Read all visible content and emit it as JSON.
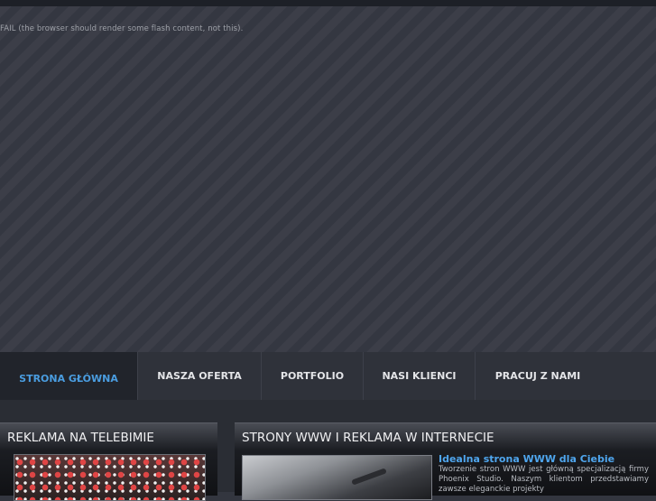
{
  "flash": {
    "fail_text": "FAIL (the browser should render some flash content, not this)."
  },
  "nav": {
    "items": [
      {
        "label": "STRONA GŁÓWNA",
        "active": true
      },
      {
        "label": "NASZA OFERTA",
        "active": false
      },
      {
        "label": "PORTFOLIO",
        "active": false
      },
      {
        "label": "NASI KLIENCI",
        "active": false
      },
      {
        "label": "PRACUJ Z NAMI",
        "active": false
      }
    ]
  },
  "panels": {
    "left": {
      "title": "REKLAMA NA TELEBIMIE"
    },
    "right": {
      "title": "STRONY WWW I REKLAMA W INTERNECIE",
      "article_title": "Idealna strona WWW dla Ciebie",
      "article_text": "Tworzenie stron WWW jest główną specjalizacją firmy Phoenix Studio. Naszym klientom przedstawiamy zawsze eleganckie projekty"
    }
  },
  "colors": {
    "accent": "#4a9de0",
    "nav_background": "#2f323a",
    "page_background": "#363943"
  }
}
